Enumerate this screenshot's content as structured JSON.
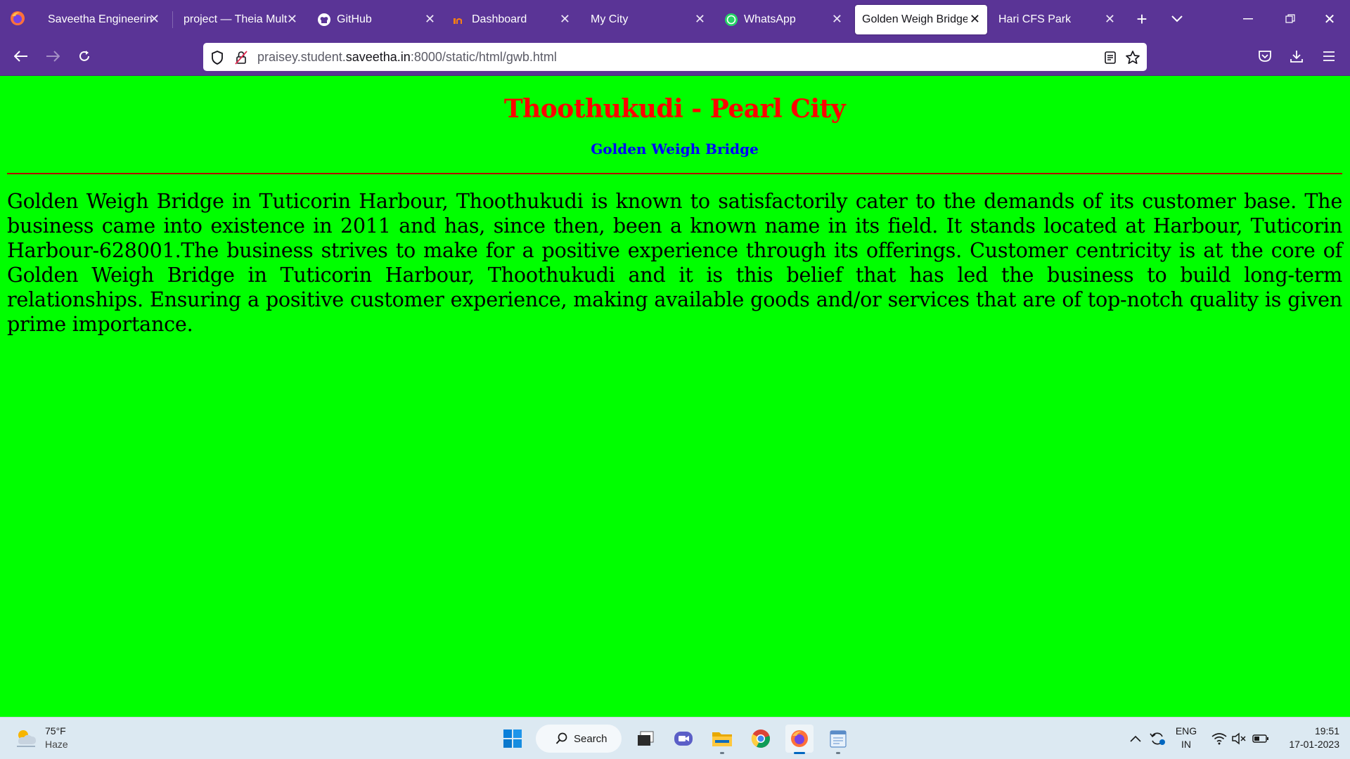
{
  "browser": {
    "tabs": [
      {
        "title": "Saveetha Engineering",
        "icon": "saveetha-favicon",
        "active": false
      },
      {
        "title": "project — Theia Multi-",
        "icon": "none",
        "active": false
      },
      {
        "title": "GitHub",
        "icon": "github-icon",
        "active": false
      },
      {
        "title": "Dashboard",
        "icon": "dashboard-favicon",
        "active": false
      },
      {
        "title": "My City",
        "icon": "none",
        "active": false
      },
      {
        "title": "WhatsApp",
        "icon": "whatsapp-icon",
        "active": false
      },
      {
        "title": "Golden Weigh Bridge",
        "icon": "none",
        "active": true
      },
      {
        "title": "Hari CFS Park",
        "icon": "none",
        "active": false
      }
    ],
    "url": {
      "prefix": "praisey.student.",
      "domain": "saveetha.in",
      "rest": ":8000/static/html/gwb.html"
    },
    "accent_color": "#5a3496"
  },
  "page": {
    "background": "#00ff00",
    "title": "Thoothukudi - Pearl City",
    "subtitle": "Golden Weigh Bridge",
    "body": "Golden Weigh Bridge in Tuticorin Harbour, Thoothukudi is known to satisfactorily cater to the demands of its customer base. The business came into existence in 2011 and has, since then, been a known name in its field. It stands located at Harbour, Tuticorin Harbour-628001.The business strives to make for a positive experience through its offerings. Customer centricity is at the core of Golden Weigh Bridge in Tuticorin Harbour, Thoothukudi and it is this belief that has led the business to build long-term relationships. Ensuring a positive customer experience, making available goods and/or services that are of top-notch quality is given prime importance."
  },
  "taskbar": {
    "weather": {
      "temp": "75°F",
      "condition": "Haze"
    },
    "search_label": "Search",
    "apps": [
      "windows-start-icon",
      "task-view-icon",
      "teams-chat-icon",
      "file-explorer-icon",
      "chrome-icon",
      "firefox-icon",
      "notepad-icon"
    ],
    "language": {
      "lang": "ENG",
      "region": "IN"
    },
    "clock": {
      "time": "19:51",
      "date": "17-01-2023"
    }
  }
}
